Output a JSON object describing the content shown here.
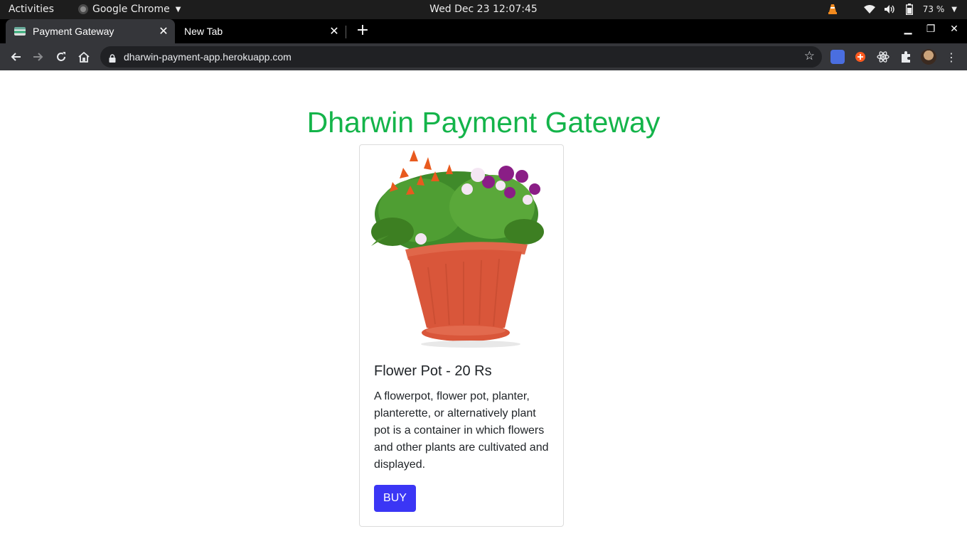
{
  "system_bar": {
    "activities": "Activities",
    "app_name": "Google Chrome",
    "datetime": "Wed Dec 23  12:07:45",
    "battery": "73 %"
  },
  "browser": {
    "tabs": [
      {
        "label": "Payment Gateway",
        "active": true
      },
      {
        "label": "New Tab",
        "active": false
      }
    ],
    "url": "dharwin-payment-app.herokuapp.com"
  },
  "page": {
    "heading": "Dharwin Payment Gateway",
    "heading_color": "#14b44a",
    "product": {
      "title": "Flower Pot - 20 Rs",
      "description": "A flowerpot, flower pot, planter, planterette, or alternatively plant pot is a container in which flowers and other plants are cultivated and displayed.",
      "buy_label": "BUY",
      "buy_color": "#3b36f5"
    }
  },
  "icons": [
    "chrome-icon",
    "back-icon",
    "forward-icon",
    "reload-icon",
    "home-icon",
    "lock-icon",
    "star-icon",
    "translate-icon",
    "extension-icon",
    "react-icon",
    "puzzle-icon",
    "avatar",
    "menu-icon",
    "wifi-icon",
    "volume-icon",
    "battery-icon",
    "vlc-icon"
  ]
}
